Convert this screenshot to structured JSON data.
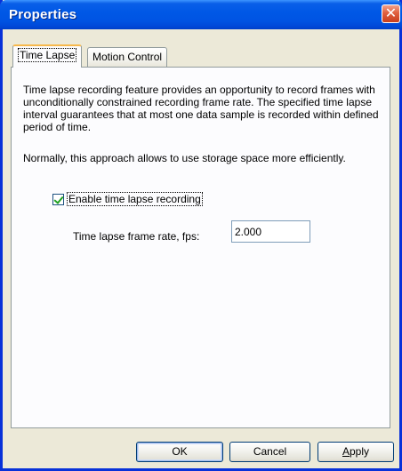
{
  "window": {
    "title": "Properties",
    "close_glyph": "✕"
  },
  "tabs": [
    {
      "label": "Time Lapse",
      "active": true
    },
    {
      "label": "Motion Control",
      "active": false
    }
  ],
  "time_lapse": {
    "description": "Time lapse recording feature provides an opportunity to record frames with unconditionally constrained recording frame rate. The specified time lapse interval guarantees that at most one data sample is recorded within defined period of time.",
    "note": "Normally, this approach allows to use storage space more efficiently.",
    "enable_checkbox": {
      "label": "Enable time lapse recording",
      "checked": true
    },
    "frame_rate": {
      "label": "Time lapse frame rate, fps:",
      "value": "2.000"
    }
  },
  "buttons": {
    "ok": "OK",
    "cancel": "Cancel",
    "apply": "Apply"
  },
  "colors": {
    "titlebar": "#0054e3",
    "dialog_bg": "#ece9d8",
    "panel_bg": "#fcfcfe",
    "active_tab_accent": "#f7b84b",
    "close_button": "#e0603f",
    "check_mark": "#21a121"
  },
  "icons": {
    "close": "close-icon",
    "check": "check-icon"
  }
}
